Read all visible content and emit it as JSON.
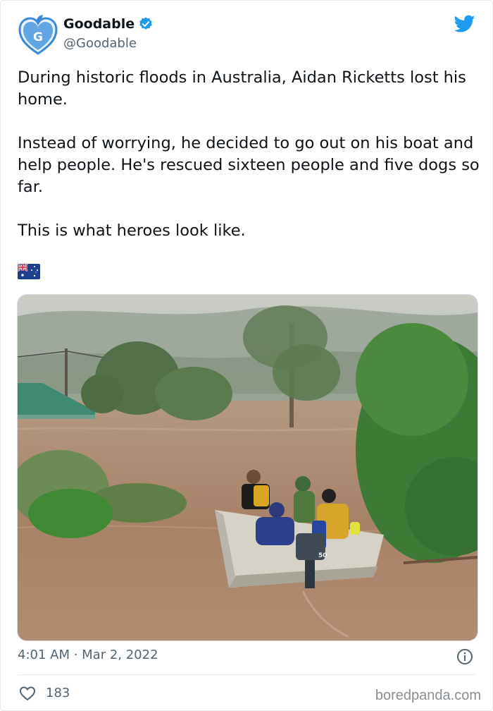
{
  "author": {
    "display_name": "Goodable",
    "handle": "@Goodable",
    "verified": true,
    "avatar_letter": "G"
  },
  "tweet": {
    "paragraphs": [
      "During historic floods in Australia, Aidan Ricketts lost his home.",
      "Instead of worrying, he decided to go out on his boat and help people. He's rescued sixteen people and five dogs so far.",
      "This is what heroes look like."
    ],
    "emoji": "australia-flag",
    "timestamp": "4:01 AM · Mar 2, 2022",
    "likes": "183"
  },
  "media": {
    "outboard_label": "50"
  },
  "watermark": "boredpanda.com",
  "colors": {
    "twitter_blue": "#1d9bf0",
    "avatar_blue": "#3a8ad6",
    "text": "#0f1419",
    "secondary_text": "#536471"
  },
  "icons": [
    "goodable-logo-icon",
    "verified-badge-icon",
    "twitter-bird-icon",
    "info-icon",
    "heart-icon"
  ]
}
